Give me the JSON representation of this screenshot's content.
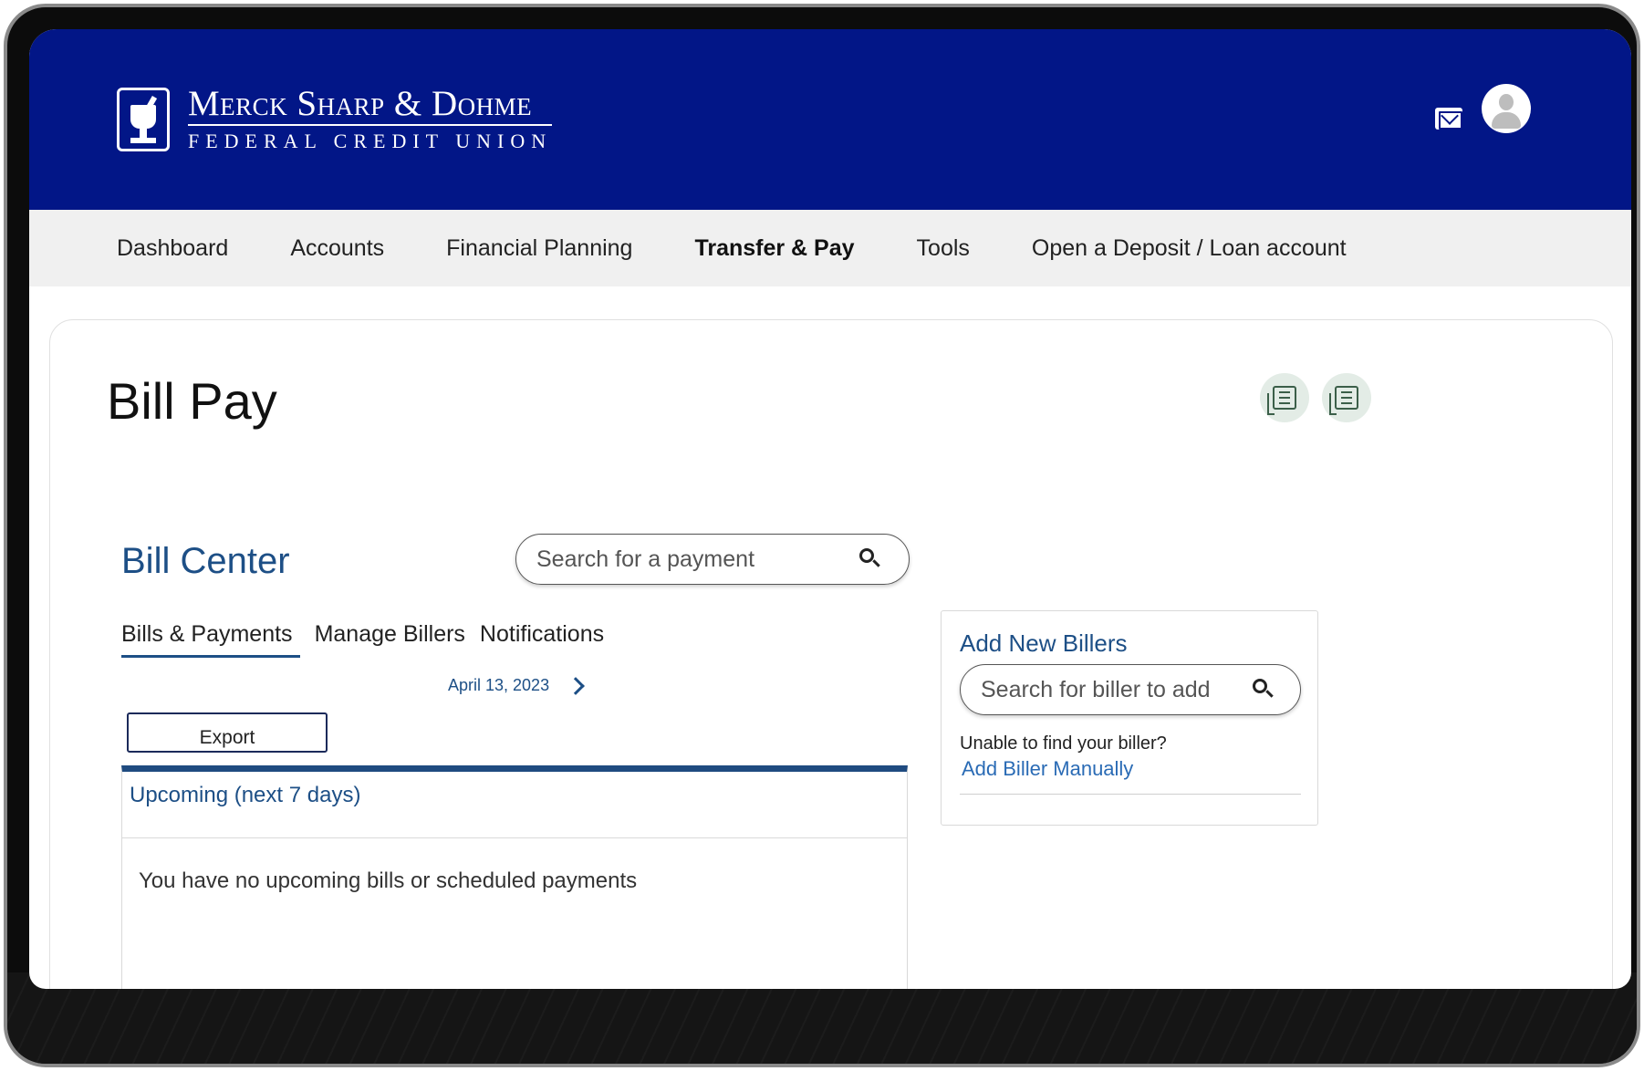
{
  "brand": {
    "name_line1": "Merck Sharp & Dohme",
    "name_line2": "FEDERAL CREDIT UNION"
  },
  "header": {
    "icons": [
      "mail-icon",
      "user-avatar-icon"
    ],
    "color": "#021687"
  },
  "nav": {
    "items": [
      {
        "label": "Dashboard",
        "active": false
      },
      {
        "label": "Accounts",
        "active": false
      },
      {
        "label": "Financial Planning",
        "active": false
      },
      {
        "label": "Transfer & Pay",
        "active": true
      },
      {
        "label": "Tools",
        "active": false
      },
      {
        "label": "Open a Deposit / Loan account",
        "active": false
      }
    ]
  },
  "page": {
    "title": "Bill Pay",
    "title_actions": [
      "document-stack-icon",
      "document-list-icon"
    ]
  },
  "bill_center": {
    "title": "Bill Center",
    "search_placeholder": "Search for a payment",
    "tabs": [
      {
        "label": "Bills & Payments",
        "active": true
      },
      {
        "label": "Manage Billers",
        "active": false
      },
      {
        "label": "Notifications",
        "active": false
      }
    ],
    "date": "April 13, 2023",
    "export_label": "Export",
    "upcoming_title": "Upcoming (next 7 days)",
    "upcoming_empty": "You have no upcoming bills or scheduled payments"
  },
  "add_billers": {
    "title": "Add New Billers",
    "search_placeholder": "Search for biller to add",
    "note": "Unable to find your biller?",
    "link": "Add Biller Manually"
  },
  "colors": {
    "accent": "#1d4f86",
    "link": "#2a6bb5",
    "header_bg": "#021687",
    "nav_bg": "#f0f0f0"
  }
}
